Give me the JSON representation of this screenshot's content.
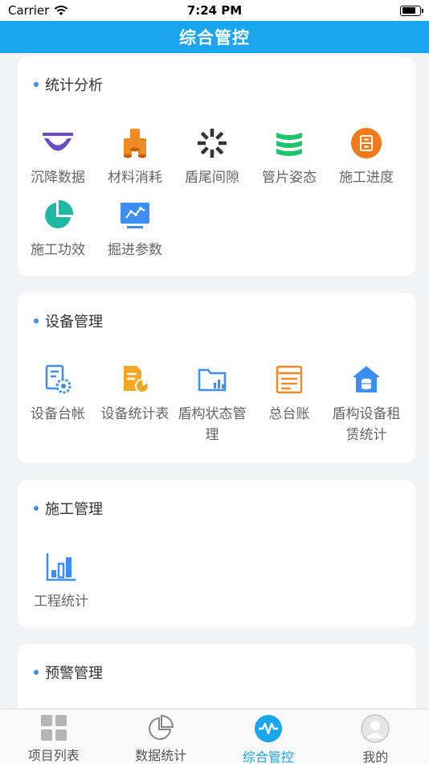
{
  "status_bar": {
    "carrier": "Carrier",
    "time": "7:24 PM"
  },
  "header": {
    "title": "综合管控"
  },
  "sections": {
    "stats": {
      "title": "统计分析",
      "items": [
        {
          "label": "沉降数据",
          "icon": "bowl-icon",
          "color": "#6a4cc4"
        },
        {
          "label": "材料消耗",
          "icon": "pipes-icon",
          "color": "#f08a24"
        },
        {
          "label": "盾尾间隙",
          "icon": "aperture-icon",
          "color": "#333333"
        },
        {
          "label": "管片姿态",
          "icon": "rings-icon",
          "color": "#1fc46a"
        },
        {
          "label": "施工进度",
          "icon": "progress-icon",
          "color": "#f07a1a"
        },
        {
          "label": "施工功效",
          "icon": "pie-icon",
          "color": "#1fb8a5"
        },
        {
          "label": "掘进参数",
          "icon": "monitor-chart-icon",
          "color": "#3d8ef0"
        }
      ]
    },
    "equipment": {
      "title": "设备管理",
      "items": [
        {
          "label": "设备台帐",
          "icon": "device-ledger-icon",
          "color": "#3d8ef0"
        },
        {
          "label": "设备统计表",
          "icon": "device-stats-icon",
          "color": "#f5a623"
        },
        {
          "label": "盾构状态管理",
          "icon": "folder-chart-icon",
          "color": "#3d8ef0"
        },
        {
          "label": "总台账",
          "icon": "ledger-icon",
          "color": "#f08a24"
        },
        {
          "label": "盾构设备租赁统计",
          "icon": "house-coins-icon",
          "color": "#3d8ef0"
        }
      ]
    },
    "construction": {
      "title": "施工管理",
      "items": [
        {
          "label": "工程统计",
          "icon": "bar-chart-icon",
          "color": "#3d8ef0"
        }
      ]
    },
    "warning": {
      "title": "预警管理"
    }
  },
  "tabs": [
    {
      "label": "项目列表",
      "icon": "grid-icon",
      "active": false
    },
    {
      "label": "数据统计",
      "icon": "pie-outline-icon",
      "active": false
    },
    {
      "label": "综合管控",
      "icon": "wave-icon",
      "active": true
    },
    {
      "label": "我的",
      "icon": "user-icon",
      "active": false
    }
  ]
}
